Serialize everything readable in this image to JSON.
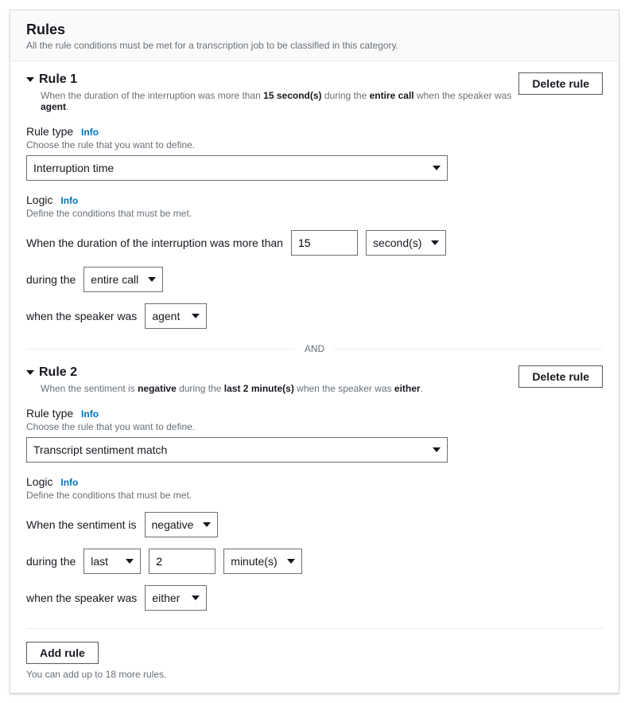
{
  "header": {
    "title": "Rules",
    "subtitle": "All the rule conditions must be met for a transcription job to be classified in this category."
  },
  "labels": {
    "delete_rule": "Delete rule",
    "rule_type": "Rule type",
    "info": "Info",
    "rule_type_hint": "Choose the rule that you want to define.",
    "logic": "Logic",
    "logic_hint": "Define the conditions that must be met.",
    "and": "AND",
    "add_rule": "Add rule",
    "remaining": "You can add up to 18 more rules."
  },
  "rule1": {
    "title": "Rule 1",
    "summary_prefix": "When the duration of the interruption was more than ",
    "summary_val": "15 second(s)",
    "summary_mid": " during the ",
    "summary_scope": "entire call",
    "summary_when": " when the speaker was ",
    "summary_speaker": "agent",
    "summary_end": ".",
    "type_value": "Interruption time",
    "logic": {
      "prefix": "When the duration of the interruption was more than",
      "value": "15",
      "unit": "second(s)",
      "during_label": "during the",
      "during_value": "entire call",
      "speaker_label": "when the speaker was",
      "speaker_value": "agent"
    }
  },
  "rule2": {
    "title": "Rule 2",
    "summary_prefix": "When the sentiment is ",
    "summary_val": "negative",
    "summary_mid": " during the ",
    "summary_scope": "last 2 minute(s)",
    "summary_when": " when the speaker was ",
    "summary_speaker": "either",
    "summary_end": ".",
    "type_value": "Transcript sentiment match",
    "logic": {
      "prefix": "When the sentiment is",
      "sentiment": "negative",
      "during_label": "during the",
      "during_mode": "last",
      "during_value": "2",
      "during_unit": "minute(s)",
      "speaker_label": "when the speaker was",
      "speaker_value": "either"
    }
  }
}
